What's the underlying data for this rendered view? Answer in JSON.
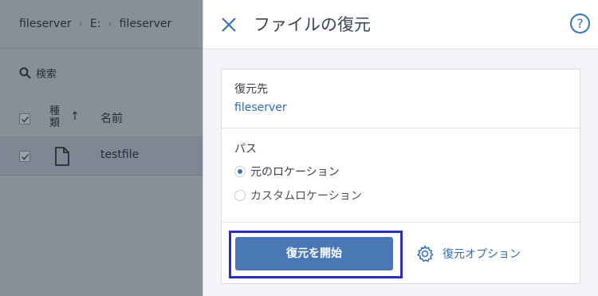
{
  "breadcrumb": {
    "items": [
      "fileserver",
      "E:",
      "fileserver"
    ]
  },
  "search": {
    "label": "検索"
  },
  "table": {
    "col_type": "種類",
    "col_name": "名前",
    "rows": [
      {
        "name": "testfile",
        "checked": true
      }
    ]
  },
  "panel": {
    "title": "ファイルの復元",
    "help_label": "?",
    "destination": {
      "label": "復元先",
      "value": "fileserver"
    },
    "path": {
      "label": "パス",
      "options": [
        {
          "label": "元のロケーション",
          "selected": true
        },
        {
          "label": "カスタムロケーション",
          "selected": false
        }
      ]
    },
    "start_button": "復元を開始",
    "options_link": "復元オプション"
  },
  "colors": {
    "accent": "#3b73b9",
    "button": "#4a78b5",
    "highlight_border": "#2d2fb8"
  },
  "icons": [
    "search-icon",
    "checkbox-icon",
    "sort-up-icon",
    "file-icon",
    "close-icon",
    "help-icon",
    "gear-icon"
  ]
}
